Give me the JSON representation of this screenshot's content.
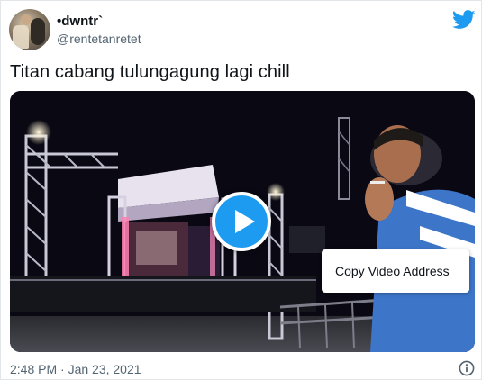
{
  "tweet": {
    "display_name": "•dwntr`",
    "handle": "@rentetanretet",
    "text": "Titan cabang tulungagung lagi chill",
    "timestamp": "2:48 PM · Jan 23, 2021"
  },
  "media": {
    "type": "video",
    "play_icon": "play-icon",
    "context_menu": {
      "item": "Copy Video Address"
    }
  },
  "icons": {
    "brand": "twitter-bird-icon",
    "info": "info-icon",
    "avatar": "avatar"
  },
  "colors": {
    "accent": "#1d9bf0",
    "secondary_text": "#536471",
    "primary_text": "#0f1419"
  }
}
